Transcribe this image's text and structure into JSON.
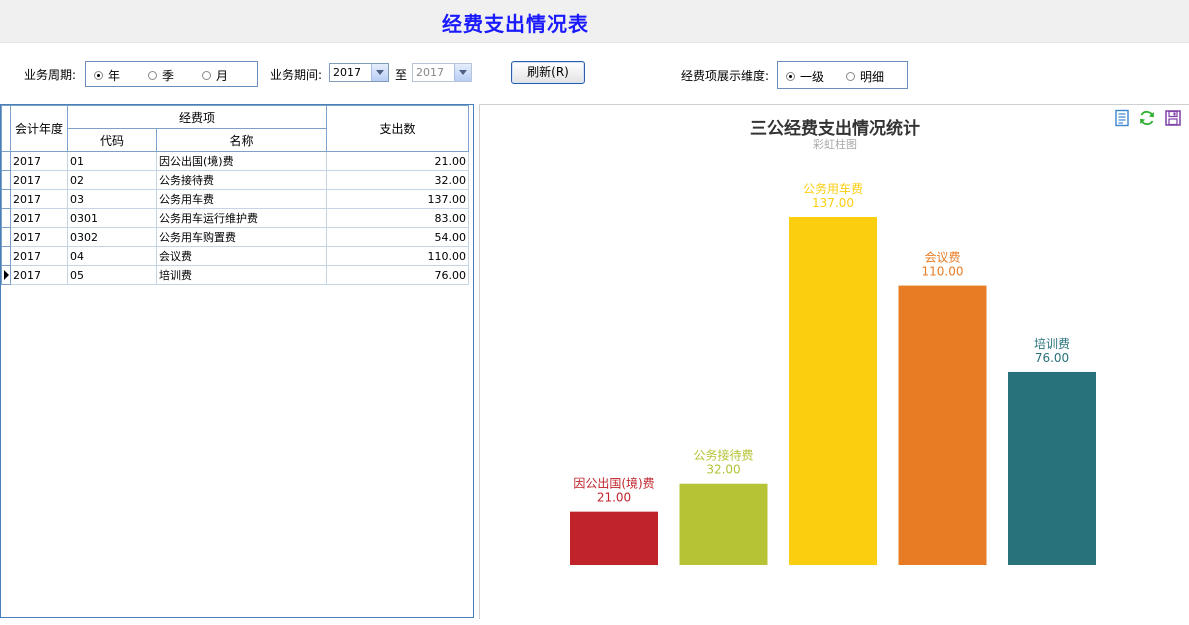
{
  "header": {
    "title": "经费支出情况表"
  },
  "filters": {
    "period_label": "业务周期:",
    "period_options": [
      {
        "label": "年",
        "selected": true
      },
      {
        "label": "季",
        "selected": false
      },
      {
        "label": "月",
        "selected": false
      }
    ],
    "range_label": "业务期间:",
    "from_value": "2017",
    "to_label": "至",
    "to_value": "2017",
    "refresh_label": "刷新(R)",
    "dimension_label": "经费项展示维度:",
    "dimension_options": [
      {
        "label": "一级",
        "selected": true
      },
      {
        "label": "明细",
        "selected": false
      }
    ]
  },
  "table": {
    "headers": {
      "year": "会计年度",
      "item_group": "经费项",
      "code": "代码",
      "name": "名称",
      "amount": "支出数"
    },
    "rows": [
      {
        "year": "2017",
        "code": "01",
        "name": "因公出国(境)费",
        "amount": "21.00"
      },
      {
        "year": "2017",
        "code": "02",
        "name": "公务接待费",
        "amount": "32.00"
      },
      {
        "year": "2017",
        "code": "03",
        "name": "公务用车费",
        "amount": "137.00"
      },
      {
        "year": "2017",
        "code": "0301",
        "name": "公务用车运行维护费",
        "amount": "83.00"
      },
      {
        "year": "2017",
        "code": "0302",
        "name": "公务用车购置费",
        "amount": "54.00"
      },
      {
        "year": "2017",
        "code": "04",
        "name": "会议费",
        "amount": "110.00"
      },
      {
        "year": "2017",
        "code": "05",
        "name": "培训费",
        "amount": "76.00",
        "current": true
      }
    ]
  },
  "chart_data": {
    "type": "bar",
    "title": "三公经费支出情况统计",
    "subtitle": "彩虹柱图",
    "categories": [
      "因公出国(境)费",
      "公务接待费",
      "公务用车费",
      "会议费",
      "培训费"
    ],
    "values": [
      21.0,
      32.0,
      137.0,
      110.0,
      76.0
    ],
    "value_labels": [
      "21.00",
      "32.00",
      "137.00",
      "110.00",
      "76.00"
    ],
    "colors": [
      "#c1232b",
      "#b5c334",
      "#fcce10",
      "#e87c25",
      "#27727b"
    ],
    "ylim": [
      0,
      140
    ],
    "grid": false,
    "legend": "none"
  },
  "toolbox": {
    "icons": [
      "data-view-icon",
      "refresh-icon",
      "save-icon"
    ]
  }
}
